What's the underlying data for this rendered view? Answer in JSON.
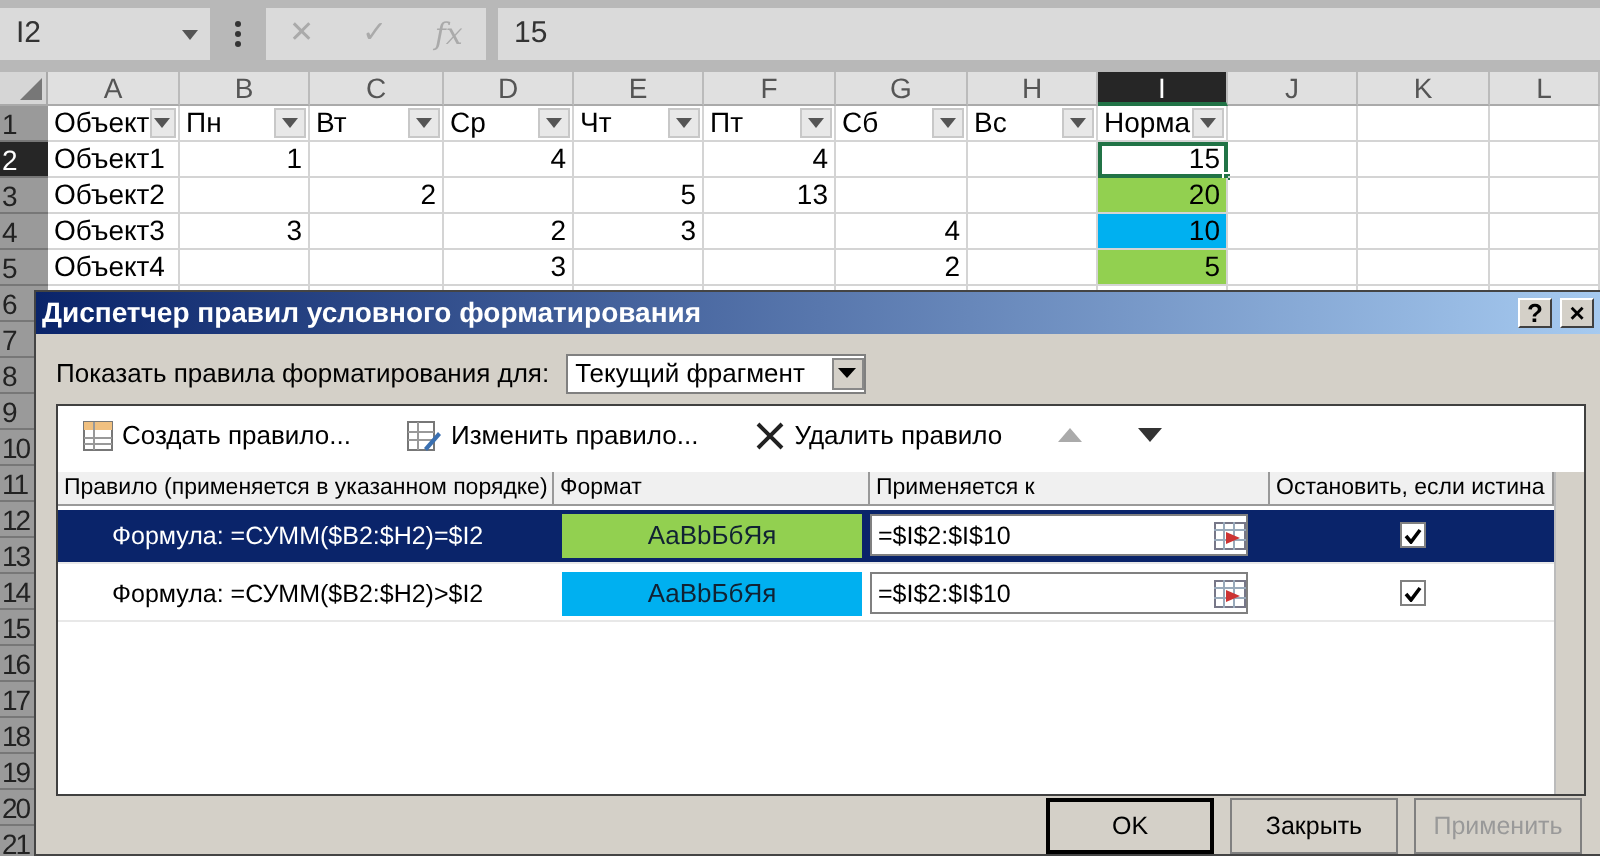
{
  "formula_bar": {
    "name_box": "I2",
    "cancel": "✕",
    "enter": "✓",
    "function": "fx",
    "value": "15"
  },
  "column_headers": [
    {
      "label": "A",
      "selected": false
    },
    {
      "label": "B",
      "selected": false
    },
    {
      "label": "C",
      "selected": false
    },
    {
      "label": "D",
      "selected": false
    },
    {
      "label": "E",
      "selected": false
    },
    {
      "label": "F",
      "selected": false
    },
    {
      "label": "G",
      "selected": false
    },
    {
      "label": "H",
      "selected": false
    },
    {
      "label": "I",
      "selected": true
    },
    {
      "label": "J",
      "selected": false
    },
    {
      "label": "K",
      "selected": false
    },
    {
      "label": "L",
      "selected": false
    }
  ],
  "row_headers": [
    {
      "label": "1",
      "selected": false
    },
    {
      "label": "2",
      "selected": true
    },
    {
      "label": "3",
      "selected": false
    },
    {
      "label": "4",
      "selected": false
    },
    {
      "label": "5",
      "selected": false
    },
    {
      "label": "6",
      "selected": false
    },
    {
      "label": "7",
      "selected": false
    },
    {
      "label": "8",
      "selected": false
    },
    {
      "label": "9",
      "selected": false
    },
    {
      "label": "10",
      "selected": false
    },
    {
      "label": "11",
      "selected": false
    },
    {
      "label": "12",
      "selected": false
    },
    {
      "label": "13",
      "selected": false
    },
    {
      "label": "14",
      "selected": false
    },
    {
      "label": "15",
      "selected": false
    },
    {
      "label": "16",
      "selected": false
    },
    {
      "label": "17",
      "selected": false
    },
    {
      "label": "18",
      "selected": false
    },
    {
      "label": "19",
      "selected": false
    },
    {
      "label": "20",
      "selected": false
    },
    {
      "label": "21",
      "selected": false
    }
  ],
  "table_headers": [
    "Объект",
    "Пн",
    "Вт",
    "Ср",
    "Чт",
    "Пт",
    "Сб",
    "Вс",
    "Норма"
  ],
  "rows": [
    {
      "cells": [
        {
          "text": "Объект1",
          "selected": false
        },
        {
          "text": "1",
          "selected": false
        },
        {
          "selected": false
        },
        {
          "text": "4",
          "selected": false
        },
        {
          "selected": false
        },
        {
          "text": "4",
          "selected": false
        },
        {
          "selected": false
        },
        {
          "selected": false
        },
        {
          "text": "15",
          "selected": true
        }
      ]
    },
    {
      "cells": [
        {
          "text": "Объект2",
          "selected": false
        },
        {
          "selected": false
        },
        {
          "text": "2",
          "selected": false
        },
        {
          "selected": false
        },
        {
          "text": "5",
          "selected": false
        },
        {
          "text": "13",
          "selected": false
        },
        {
          "selected": false
        },
        {
          "selected": false
        },
        {
          "text": "20",
          "selected": false,
          "color": "#92d050"
        }
      ]
    },
    {
      "cells": [
        {
          "text": "Объект3",
          "selected": false
        },
        {
          "text": "3",
          "selected": false
        },
        {
          "selected": false
        },
        {
          "text": "2",
          "selected": false
        },
        {
          "text": "3",
          "selected": false
        },
        {
          "selected": false
        },
        {
          "text": "4",
          "selected": false
        },
        {
          "selected": false
        },
        {
          "text": "10",
          "selected": false,
          "color": "#00b0f0"
        }
      ]
    },
    {
      "cells": [
        {
          "text": "Объект4",
          "selected": false
        },
        {
          "selected": false
        },
        {
          "selected": false
        },
        {
          "text": "3",
          "selected": false
        },
        {
          "selected": false
        },
        {
          "selected": false
        },
        {
          "text": "2",
          "selected": false
        },
        {
          "selected": false
        },
        {
          "text": "5",
          "selected": false,
          "color": "#92d050"
        }
      ]
    }
  ],
  "dialog": {
    "title": "Диспетчер правил условного форматирования",
    "help": "?",
    "close": "×",
    "scope_label": "Показать правила форматирования для:",
    "scope_value": "Текущий фрагмент",
    "toolbar": [
      {
        "kind": "new",
        "label": "Создать правило...",
        "disabled": false
      },
      {
        "kind": "edit",
        "label": "Изменить правило...",
        "disabled": false
      },
      {
        "kind": "delete",
        "label": "Удалить правило",
        "disabled": false
      },
      {
        "kind": "up",
        "disabled": true
      },
      {
        "kind": "down",
        "disabled": false
      }
    ],
    "columns": [
      "Правило (применяется в указанном порядке)",
      "Формат",
      "Применяется к",
      "Остановить, если истина"
    ],
    "rules": [
      {
        "formula": "Формула: =СУММ($B2:$H2)=$I2",
        "sample": "АаBbБбЯя",
        "color": "#92d050",
        "applies_to": "=$I$2:$I$10",
        "stop_if_true": true,
        "selected": true
      },
      {
        "formula": "Формула: =СУММ($B2:$H2)>$I2",
        "sample": "АаBbБбЯя",
        "color": "#00b0f0",
        "applies_to": "=$I$2:$I$10",
        "stop_if_true": true,
        "selected": false
      }
    ],
    "buttons": [
      {
        "label": "OK",
        "default": true,
        "disabled": false
      },
      {
        "label": "Закрыть",
        "default": false,
        "disabled": false
      },
      {
        "label": "Применить",
        "default": false,
        "disabled": true
      }
    ]
  }
}
